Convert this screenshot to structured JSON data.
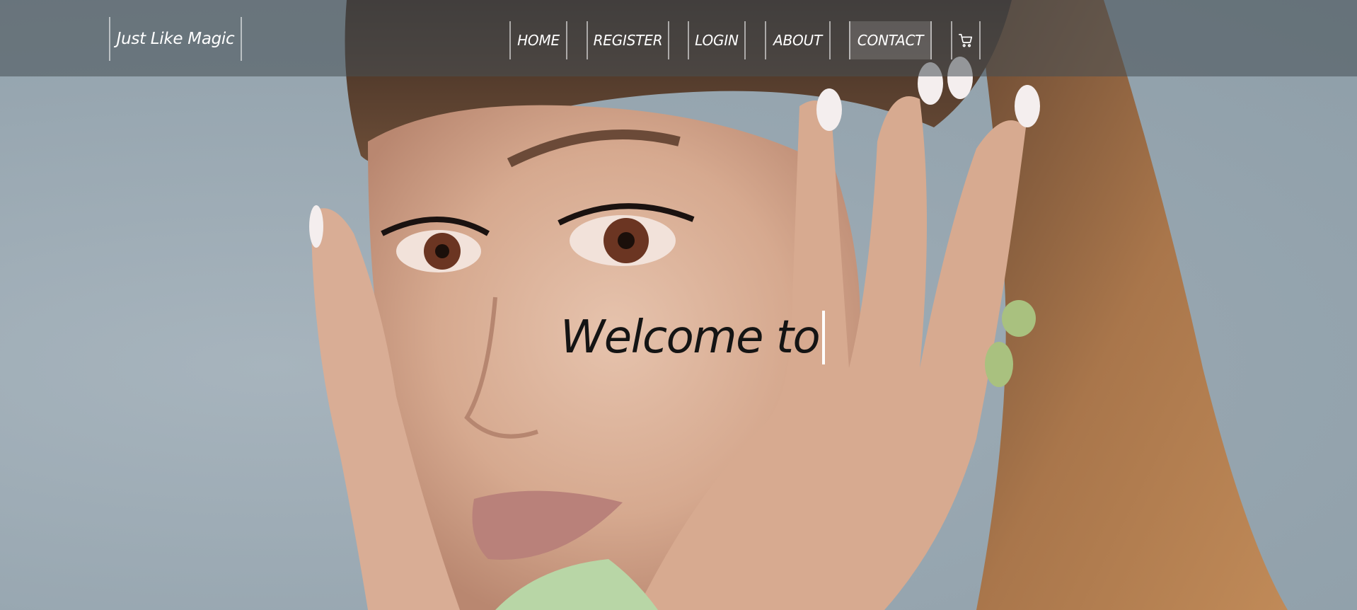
{
  "brand": {
    "name": "Just Like Magic"
  },
  "nav": {
    "items": [
      {
        "label": "HOME"
      },
      {
        "label": "REGISTER"
      },
      {
        "label": "LOGIN"
      },
      {
        "label": "ABOUT"
      },
      {
        "label": "CONTACT",
        "active": true
      }
    ],
    "cart_icon": "shopping-cart-icon"
  },
  "hero": {
    "heading": "Welcome to",
    "background": "portrait photo of a woman with hands framing her face on a gray-blue backdrop"
  },
  "colors": {
    "navbar_bg": "#464e54",
    "nav_text": "#ffffff",
    "heading_text": "#141414",
    "backdrop": "#9aa8b1"
  }
}
